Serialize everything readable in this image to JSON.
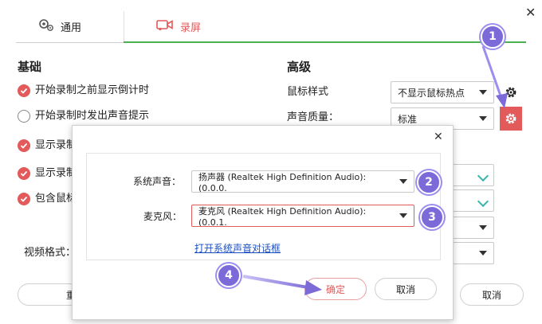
{
  "tabs": [
    {
      "label": "通用",
      "icon": "gears-icon",
      "active": false
    },
    {
      "label": "录屏",
      "icon": "video-camera-icon",
      "active": true
    }
  ],
  "basic": {
    "title": "基础",
    "options": [
      {
        "label": "开始录制之前显示倒计时",
        "checked": true
      },
      {
        "label": "开始录制时发出声音提示",
        "checked": false
      },
      {
        "label": "显示录制",
        "checked": true
      },
      {
        "label": "显示录制",
        "checked": true
      },
      {
        "label": "包含鼠标",
        "checked": true
      }
    ],
    "video_format_label": "视频格式："
  },
  "advanced": {
    "title": "高级",
    "mouse_style_label": "鼠标样式",
    "mouse_style_value": "不显示鼠标热点",
    "sound_quality_label": "声音质量：",
    "sound_quality_value": "标准"
  },
  "bottom": {
    "left_button_label": "重",
    "cancel_label": "取消"
  },
  "dialog": {
    "system_sound_label": "系统声音：",
    "system_sound_value": "扬声器 (Realtek High Definition Audio): (0.0.0.",
    "mic_label": "麦克风：",
    "mic_value": "麦克风 (Realtek High Definition Audio): (0.0.1.",
    "open_link": "打开系统声音对话框",
    "ok_label": "确定",
    "cancel_label": "取消"
  },
  "annotations": [
    "1",
    "2",
    "3",
    "4"
  ],
  "colors": {
    "accent_red": "#e25a5a",
    "tab_green": "#4caf50",
    "annot_purple": "#7b6ad8",
    "link_blue": "#1a4fc4"
  }
}
